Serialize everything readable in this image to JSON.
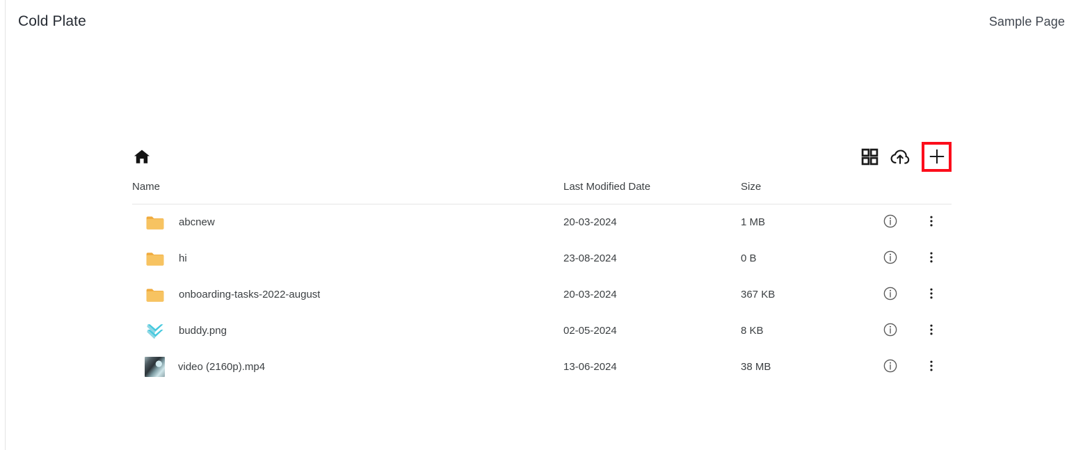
{
  "topbar": {
    "app_title": "Cold Plate",
    "sample_page_label": "Sample Page"
  },
  "file_manager": {
    "toolbar": {
      "home_icon": "home-icon",
      "grid_view_label": "grid-view-icon",
      "cloud_upload_label": "cloud-upload-icon",
      "add_label": "plus-icon",
      "highlight_color": "#fc0d1b"
    },
    "columns": {
      "name": "Name",
      "last_modified": "Last Modified Date",
      "size": "Size",
      "info": "",
      "menu": ""
    },
    "rows": [
      {
        "icon": "folder-icon",
        "name": "abcnew",
        "last_modified": "20-03-2024",
        "size": "1 MB",
        "info_icon": "info-icon",
        "menu_icon": "more-vertical-icon"
      },
      {
        "icon": "folder-icon",
        "name": "hi",
        "last_modified": "23-08-2024",
        "size": "0 B",
        "info_icon": "info-icon",
        "menu_icon": "more-vertical-icon"
      },
      {
        "icon": "folder-icon",
        "name": "onboarding-tasks-2022-august",
        "last_modified": "20-03-2024",
        "size": "367 KB",
        "info_icon": "info-icon",
        "menu_icon": "more-vertical-icon"
      },
      {
        "icon": "chevron-double-down-image-icon",
        "name": "buddy.png",
        "last_modified": "02-05-2024",
        "size": "8 KB",
        "info_icon": "info-icon",
        "menu_icon": "more-vertical-icon"
      },
      {
        "icon": "video-thumbnail-icon",
        "name": "video (2160p).mp4",
        "last_modified": "13-06-2024",
        "size": "38 MB",
        "info_icon": "info-icon",
        "menu_icon": "more-vertical-icon"
      }
    ]
  },
  "colors": {
    "folder": "#f5b councils"
  }
}
